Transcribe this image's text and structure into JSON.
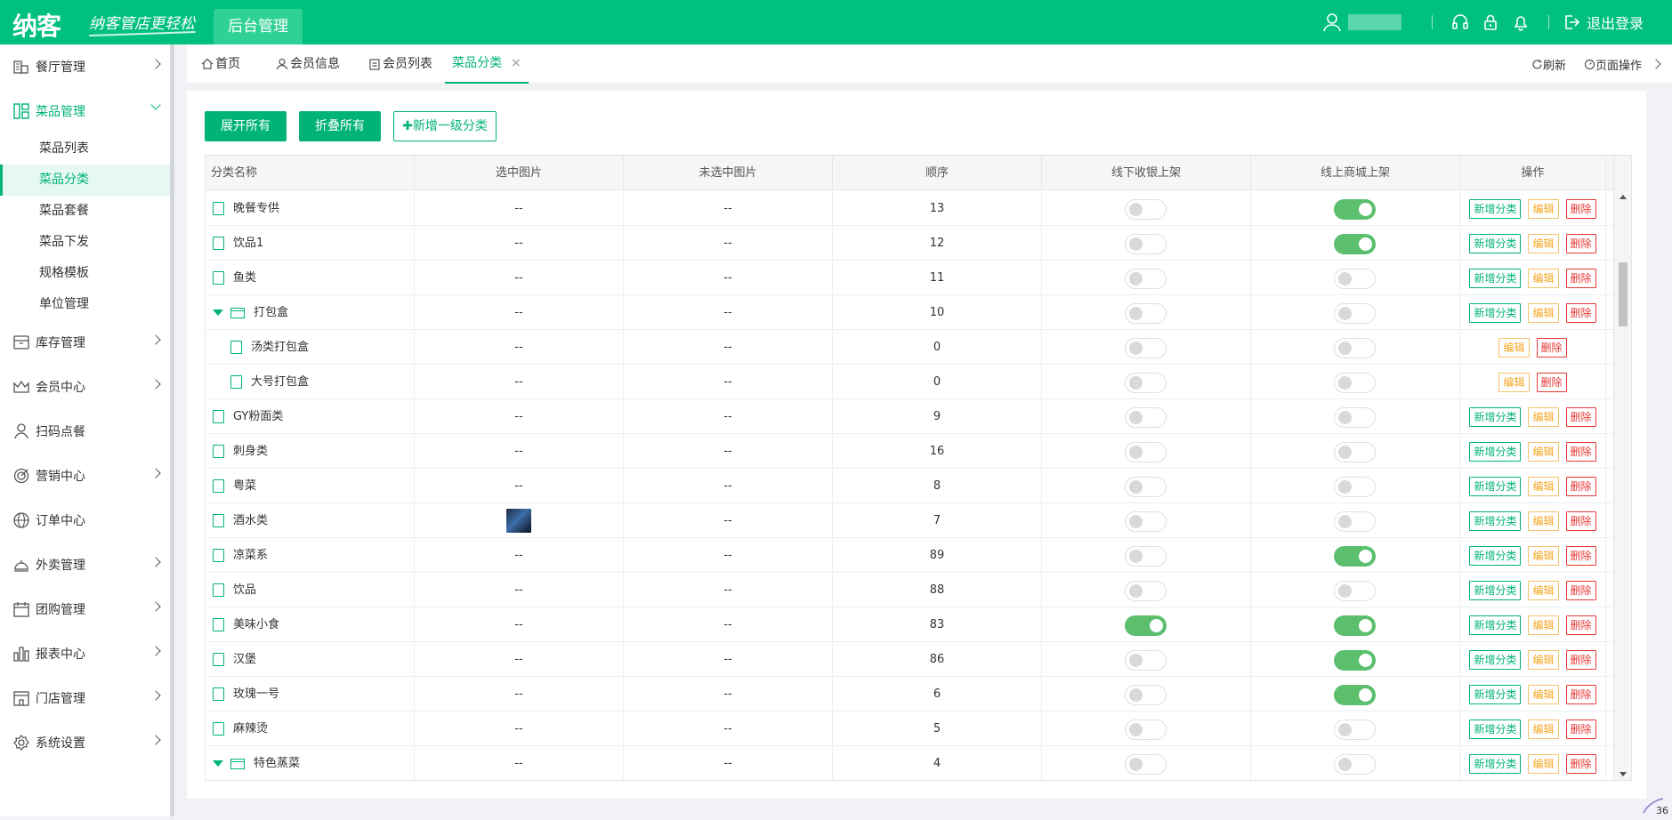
{
  "brand": {
    "logo": "纳客",
    "slogan": "纳客管店更轻松",
    "admin_tab": "后台管理"
  },
  "header": {
    "logout": "退出登录"
  },
  "sidebar": {
    "items": [
      {
        "label": "餐厅管理",
        "icon": "restaurant-icon",
        "open": false
      },
      {
        "label": "菜品管理",
        "icon": "dish-icon",
        "open": true,
        "children": [
          "菜品列表",
          "菜品分类",
          "菜品套餐",
          "菜品下发",
          "规格模板",
          "单位管理"
        ],
        "active_child": "菜品分类"
      },
      {
        "label": "库存管理",
        "icon": "inventory-icon",
        "open": false
      },
      {
        "label": "会员中心",
        "icon": "crown-icon",
        "open": false
      },
      {
        "label": "扫码点餐",
        "icon": "person-icon",
        "open": false
      },
      {
        "label": "营销中心",
        "icon": "target-icon",
        "open": false
      },
      {
        "label": "订单中心",
        "icon": "globe-icon",
        "open": false
      },
      {
        "label": "外卖管理",
        "icon": "cloche-icon",
        "open": false
      },
      {
        "label": "团购管理",
        "icon": "calendar-icon",
        "open": false
      },
      {
        "label": "报表中心",
        "icon": "bar-chart-icon",
        "open": false
      },
      {
        "label": "门店管理",
        "icon": "store-icon",
        "open": false
      },
      {
        "label": "系统设置",
        "icon": "gear-icon",
        "open": false
      }
    ]
  },
  "tabs": {
    "home": "首页",
    "member_info": "会员信息",
    "member_list": "会员列表",
    "dish_category": "菜品分类",
    "close": "×",
    "refresh": "刷新",
    "page_ops": "页面操作"
  },
  "toolbar": {
    "expand_all": "展开所有",
    "collapse_all": "折叠所有",
    "add_top_level": "✚新增一级分类"
  },
  "table": {
    "columns": [
      "分类名称",
      "选中图片",
      "未选中图片",
      "顺序",
      "线下收银上架",
      "线上商城上架",
      "操作"
    ],
    "op_labels": {
      "add": "新增分类",
      "edit": "编辑",
      "delete": "删除"
    },
    "rows": [
      {
        "name": "晚餐专供",
        "type": "leaf",
        "indent": 0,
        "selected_img": "--",
        "unselected_img": "--",
        "order": "13",
        "offline": false,
        "online": true,
        "can_add": true
      },
      {
        "name": "饮品1",
        "type": "leaf",
        "indent": 0,
        "selected_img": "--",
        "unselected_img": "--",
        "order": "12",
        "offline": false,
        "online": true,
        "can_add": true
      },
      {
        "name": "鱼类",
        "type": "leaf",
        "indent": 0,
        "selected_img": "--",
        "unselected_img": "--",
        "order": "11",
        "offline": false,
        "online": false,
        "can_add": true
      },
      {
        "name": "打包盒",
        "type": "folder",
        "indent": 0,
        "selected_img": "--",
        "unselected_img": "--",
        "order": "10",
        "offline": false,
        "online": false,
        "can_add": true
      },
      {
        "name": "汤类打包盒",
        "type": "leaf",
        "indent": 1,
        "selected_img": "--",
        "unselected_img": "--",
        "order": "0",
        "offline": false,
        "online": false,
        "can_add": false
      },
      {
        "name": "大号打包盒",
        "type": "leaf",
        "indent": 1,
        "selected_img": "--",
        "unselected_img": "--",
        "order": "0",
        "offline": false,
        "online": false,
        "can_add": false
      },
      {
        "name": "GY粉面类",
        "type": "leaf",
        "indent": 0,
        "selected_img": "--",
        "unselected_img": "--",
        "order": "9",
        "offline": false,
        "online": false,
        "can_add": true
      },
      {
        "name": "刺身类",
        "type": "leaf",
        "indent": 0,
        "selected_img": "--",
        "unselected_img": "--",
        "order": "16",
        "offline": false,
        "online": false,
        "can_add": true
      },
      {
        "name": "粤菜",
        "type": "leaf",
        "indent": 0,
        "selected_img": "--",
        "unselected_img": "--",
        "order": "8",
        "offline": false,
        "online": false,
        "can_add": true
      },
      {
        "name": "酒水类",
        "type": "leaf",
        "indent": 0,
        "selected_img": "image",
        "unselected_img": "--",
        "order": "7",
        "offline": false,
        "online": false,
        "can_add": true
      },
      {
        "name": "凉菜系",
        "type": "leaf",
        "indent": 0,
        "selected_img": "--",
        "unselected_img": "--",
        "order": "89",
        "offline": false,
        "online": true,
        "can_add": true
      },
      {
        "name": "饮品",
        "type": "leaf",
        "indent": 0,
        "selected_img": "--",
        "unselected_img": "--",
        "order": "88",
        "offline": false,
        "online": false,
        "can_add": true
      },
      {
        "name": "美味小食",
        "type": "leaf",
        "indent": 0,
        "selected_img": "--",
        "unselected_img": "--",
        "order": "83",
        "offline": true,
        "online": true,
        "can_add": true
      },
      {
        "name": "汉堡",
        "type": "leaf",
        "indent": 0,
        "selected_img": "--",
        "unselected_img": "--",
        "order": "86",
        "offline": false,
        "online": true,
        "can_add": true
      },
      {
        "name": "玫瑰一号",
        "type": "leaf",
        "indent": 0,
        "selected_img": "--",
        "unselected_img": "--",
        "order": "6",
        "offline": false,
        "online": true,
        "can_add": true
      },
      {
        "name": "麻辣烫",
        "type": "leaf",
        "indent": 0,
        "selected_img": "--",
        "unselected_img": "--",
        "order": "5",
        "offline": false,
        "online": false,
        "can_add": true
      },
      {
        "name": "特色蒸菜",
        "type": "folder",
        "indent": 0,
        "selected_img": "--",
        "unselected_img": "--",
        "order": "4",
        "offline": false,
        "online": false,
        "can_add": true
      }
    ]
  },
  "corner_badge": "36",
  "colors": {
    "primary": "#00c07f",
    "accent": "#00b377",
    "switch_on": "#5bbf6e",
    "edit": "#f5a623",
    "delete": "#e53935"
  }
}
